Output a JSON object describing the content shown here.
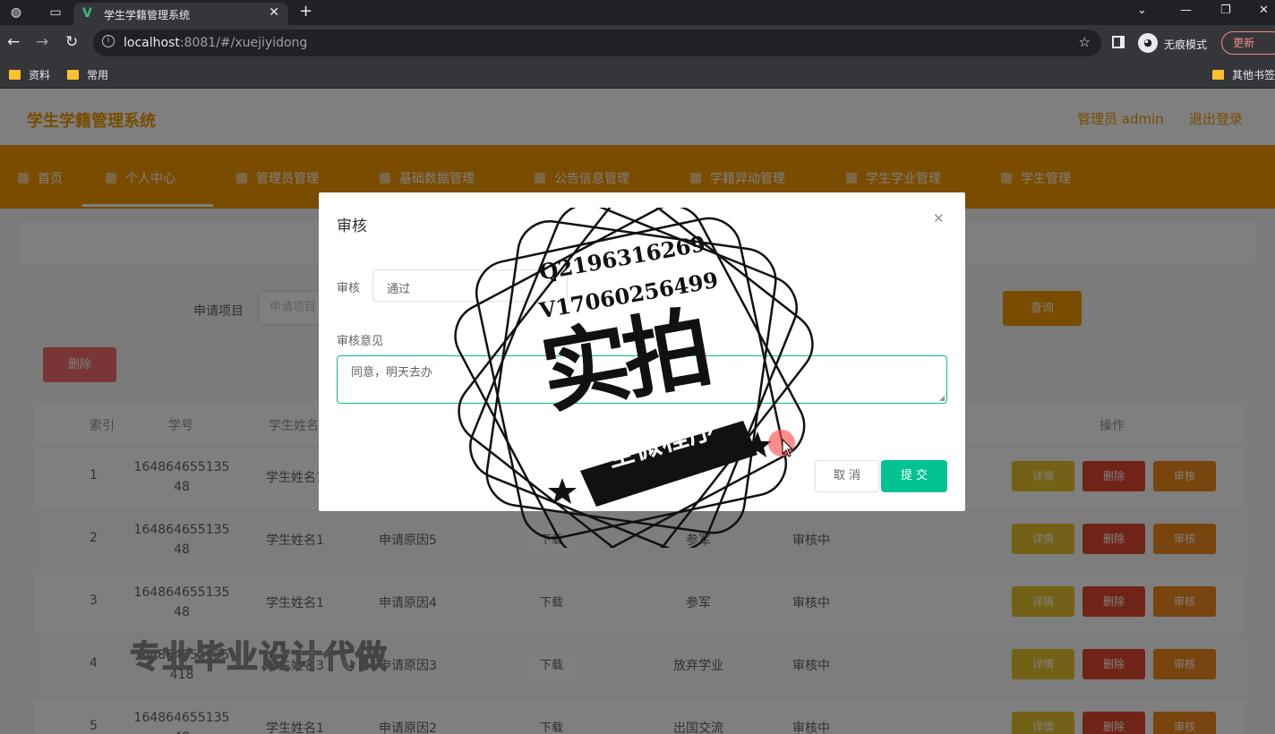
{
  "browser": {
    "tab_title": "学生学籍管理系统",
    "url_host": "localhost",
    "url_rest": ":8081/#/xuejiyidong",
    "incognito_label": "无痕模式",
    "update_label": "更新",
    "bookmarks": [
      "资料",
      "常用"
    ],
    "other_bookmarks": "其他书签"
  },
  "header": {
    "title": "学生学籍管理系统",
    "admin_label": "管理员 admin",
    "logout_label": "退出登录"
  },
  "nav": {
    "items": [
      "首页",
      "个人中心",
      "管理员管理",
      "基础数据管理",
      "公告信息管理",
      "学籍异动管理",
      "学生学业管理",
      "学生管理"
    ]
  },
  "search": {
    "label": "申请项目",
    "placeholder": "申请项目",
    "query_label": "查询"
  },
  "toolbar": {
    "delete_label": "删除"
  },
  "table": {
    "headers": [
      "索引",
      "学号",
      "学生姓名",
      "操作"
    ],
    "rows": [
      {
        "index": "1",
        "sid": "164864655135 48",
        "name": "学生姓名1",
        "reason": "",
        "download": "",
        "type": "",
        "status": ""
      },
      {
        "index": "2",
        "sid": "164864655135 48",
        "name": "学生姓名1",
        "reason": "申请原因5",
        "download": "下载",
        "type": "参军",
        "status": "审核中"
      },
      {
        "index": "3",
        "sid": "164864655135 48",
        "name": "学生姓名1",
        "reason": "申请原因4",
        "download": "下载",
        "type": "参军",
        "status": "审核中"
      },
      {
        "index": "4",
        "sid": "164864655135 418",
        "name": "学生姓名3",
        "reason": "申请原因3",
        "download": "下载",
        "type": "放弃学业",
        "status": "审核中"
      },
      {
        "index": "5",
        "sid": "164864655135 48",
        "name": "学生姓名1",
        "reason": "申请原因2",
        "download": "下载",
        "type": "出国交流",
        "status": "审核中"
      }
    ],
    "actions": {
      "detail": "详情",
      "delete": "删除",
      "audit": "审核"
    }
  },
  "dialog": {
    "title": "审核",
    "audit_label": "审核",
    "audit_value": "通过",
    "opinion_label": "审核意见",
    "opinion_value": "同意，明天去办",
    "cancel_label": "取 消",
    "submit_label": "提 交"
  },
  "watermark": {
    "line1": "Q2196316269",
    "line2": "V17060256499",
    "big": "实拍",
    "ribbon": "全微程序",
    "bottom": "专业毕业设计代做"
  }
}
